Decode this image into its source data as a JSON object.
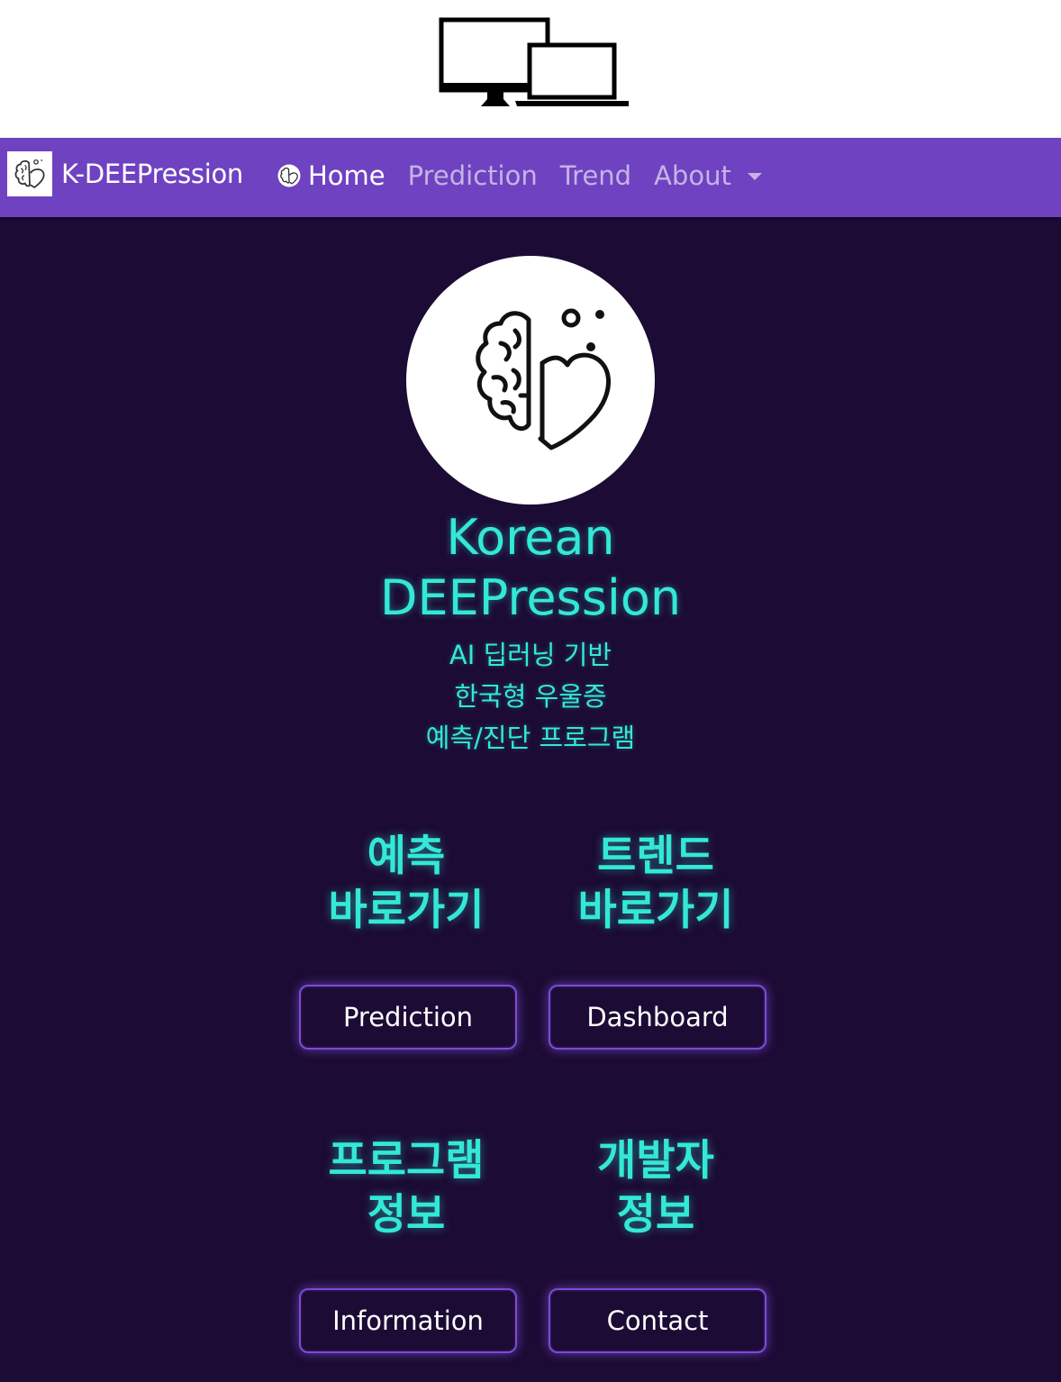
{
  "header_icon": "desktop-laptop-devices-icon",
  "navbar": {
    "brand": {
      "logo_icon": "brain-heart-icon",
      "text": "K-DEEPression"
    },
    "links": [
      {
        "label": "Home",
        "icon": "brain-heart-icon",
        "active": true
      },
      {
        "label": "Prediction",
        "active": false
      },
      {
        "label": "Trend",
        "active": false
      },
      {
        "label": "About",
        "active": false,
        "dropdown": true
      }
    ],
    "background_color": "#6f42c1"
  },
  "hero": {
    "logo_icon": "brain-heart-icon",
    "title_line1": "Korean",
    "title_line2": "DEEPression",
    "subtitle_lines": [
      "AI 딥러닝 기반",
      "한국형 우울증",
      "예측/진단 프로그램"
    ]
  },
  "cards": [
    {
      "heading_line1": "예측",
      "heading_line2": "바로가기",
      "button": "Prediction"
    },
    {
      "heading_line1": "트렌드",
      "heading_line2": "바로가기",
      "button": "Dashboard"
    },
    {
      "heading_line1": "프로그램",
      "heading_line2": "정보",
      "button": "Information"
    },
    {
      "heading_line1": "개발자",
      "heading_line2": "정보",
      "button": "Contact"
    }
  ],
  "colors": {
    "accent": "#33e8d6",
    "background": "#1c0b34",
    "button_border": "#7b4bd6"
  }
}
